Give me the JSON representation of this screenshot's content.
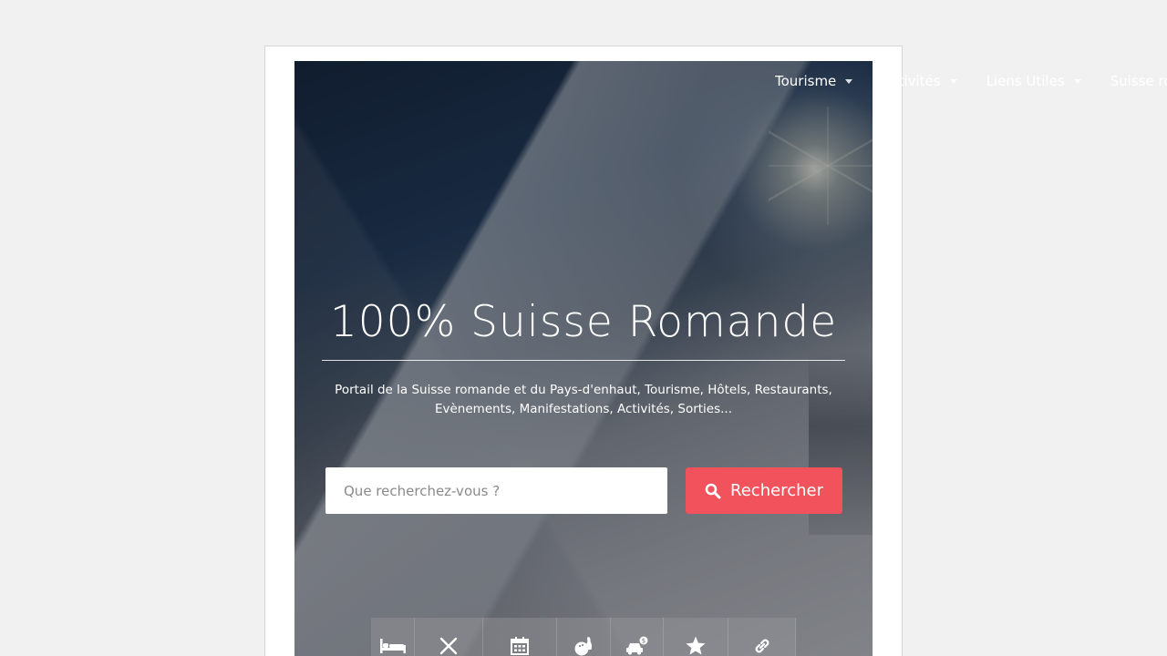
{
  "nav": {
    "items": [
      {
        "label": "Tourisme",
        "icon": "caret-down-icon"
      },
      {
        "label": "Activités",
        "icon": "caret-down-icon"
      },
      {
        "label": "Liens Utiles",
        "icon": "caret-down-icon"
      },
      {
        "label": "Suisse romande",
        "icon": ""
      }
    ]
  },
  "hero": {
    "title": "100% Suisse Romande",
    "subtitle_line1": "Portail de la Suisse romande et du Pays-d'enhaut, Tourisme, Hôtels, Restaurants,",
    "subtitle_line2": "Evènements, Manifestations, Activités, Sorties..."
  },
  "search": {
    "placeholder": "Que recherchez-vous ?",
    "button_label": "Rechercher",
    "button_color": "#f2525b"
  },
  "categories": [
    {
      "icon": "bed-icon"
    },
    {
      "icon": "utensils-icon"
    },
    {
      "icon": "calendar-icon"
    },
    {
      "icon": "bowling-icon"
    },
    {
      "icon": "car-dollar-icon"
    },
    {
      "icon": "star-icon"
    },
    {
      "icon": "link-icon"
    }
  ]
}
